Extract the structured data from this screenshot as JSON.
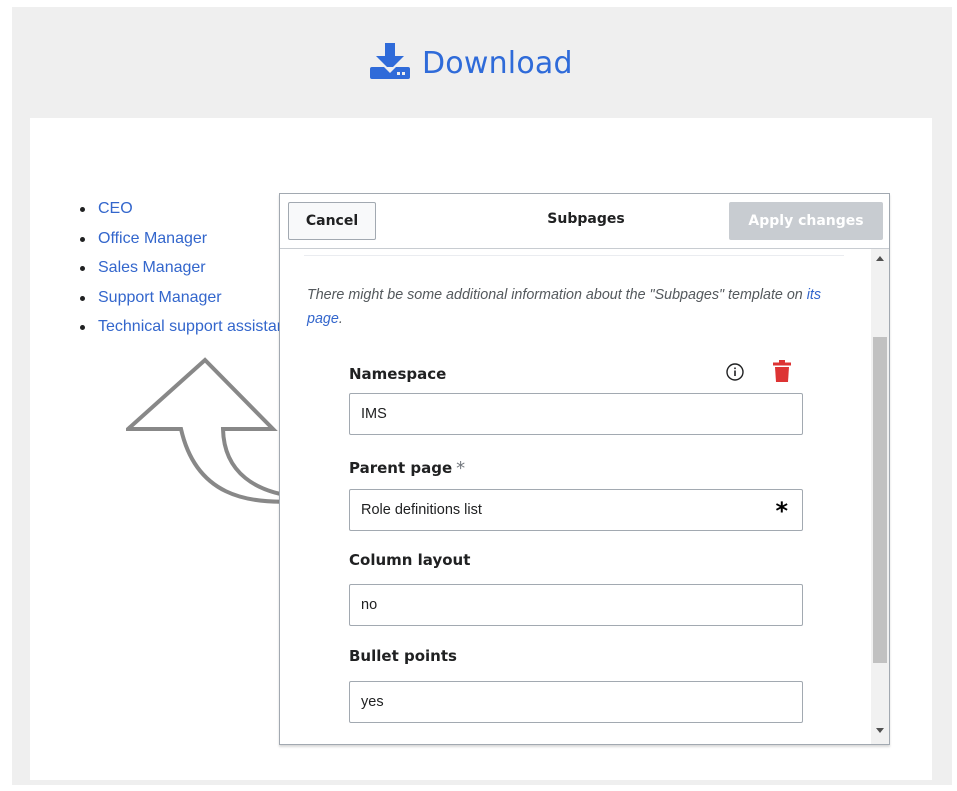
{
  "download": {
    "label": "Download",
    "icon": "download-icon"
  },
  "page_list": {
    "items": [
      {
        "label": "CEO"
      },
      {
        "label": "Office Manager"
      },
      {
        "label": "Sales Manager"
      },
      {
        "label": "Support Manager"
      },
      {
        "label": "Technical support assistant"
      }
    ]
  },
  "dialog": {
    "title": "Subpages",
    "cancel_label": "Cancel",
    "apply_label": "Apply changes",
    "info_prefix": "There might be some additional information about the \"Subpages\" template on ",
    "info_link": "its page",
    "info_suffix": ".",
    "fields": [
      {
        "label": "Namespace",
        "value": "IMS"
      },
      {
        "label": "Parent page",
        "required_mark": "*",
        "value": "Role definitions list",
        "value_mark": "*"
      },
      {
        "label": "Column layout",
        "value": "no"
      },
      {
        "label": "Bullet points",
        "value": "yes"
      }
    ]
  },
  "colors": {
    "link": "#3366cc",
    "download": "#2f6bd9",
    "delete": "#d33",
    "apply_disabled": "#c8ccd1",
    "background": "#efefef"
  }
}
